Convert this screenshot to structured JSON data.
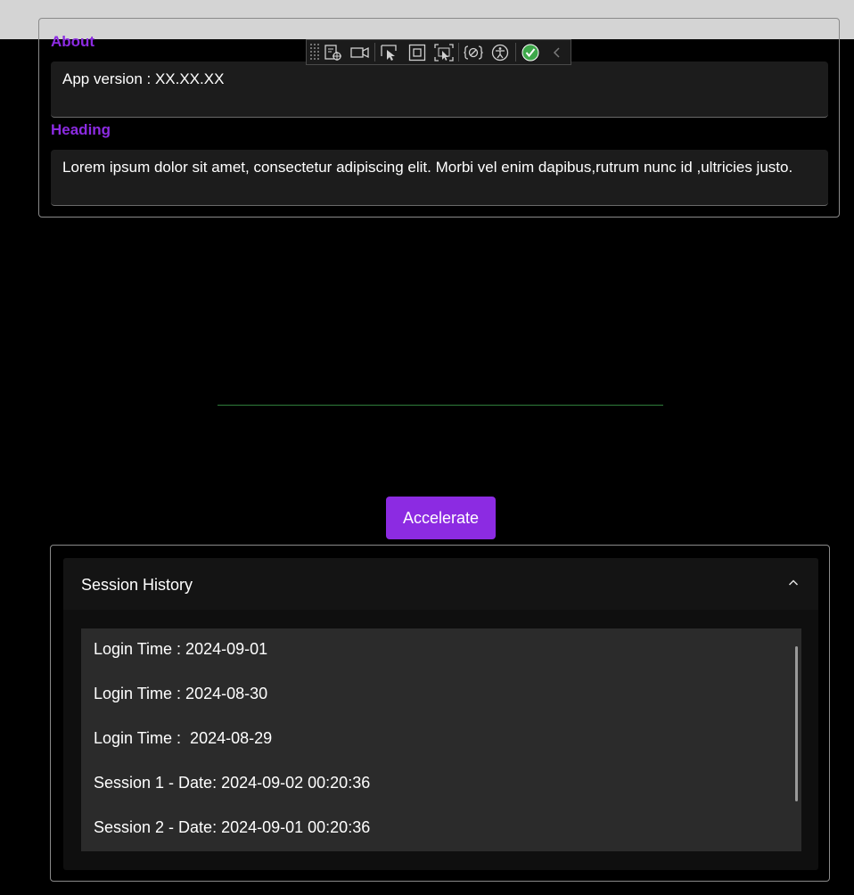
{
  "about": {
    "title": "About",
    "app_version": "App version : XX.XX.XX"
  },
  "heading": {
    "title": "Heading",
    "text": "Lorem ipsum dolor sit amet, consectetur adipiscing elit. Morbi vel enim dapibus,rutrum nunc id ,ultricies justo."
  },
  "toolbar": {
    "icons": [
      "grip-icon",
      "live-visual-tree-icon",
      "record-icon",
      "select-element-icon",
      "display-layout-adorners-icon",
      "track-focused-element-icon",
      "binding-failures-icon",
      "accessibility-icon",
      "hot-reload-ok-icon",
      "collapse-chevron-icon"
    ]
  },
  "actions": {
    "accelerate_label": "Accelerate"
  },
  "session_history": {
    "title": "Session History",
    "items": [
      "Login Time : 2024-09-01",
      "Login Time : 2024-08-30",
      "Login Time :  2024-08-29",
      "Session 1 - Date: 2024-09-02 00:20:36",
      "Session 2 - Date: 2024-09-01 00:20:36"
    ]
  },
  "colors": {
    "accent": "#8c2be2",
    "background": "#000000",
    "field_bg": "#1c1c1c",
    "list_bg": "#2b2b2b",
    "divider": "#2f7d3a"
  }
}
